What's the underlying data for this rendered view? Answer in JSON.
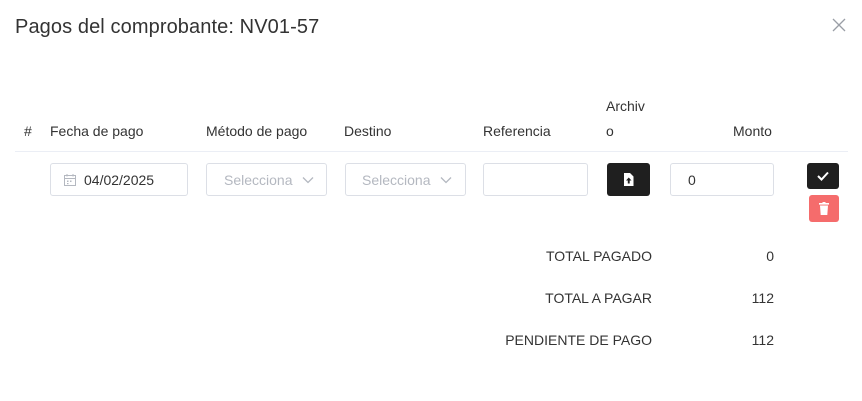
{
  "dialog": {
    "title": "Pagos del comprobante: NV01-57"
  },
  "icons": {
    "close": "close-icon",
    "calendar": "calendar-icon",
    "chevron": "chevron-down-icon",
    "upload": "upload-file-icon",
    "check": "check-icon",
    "trash": "trash-icon"
  },
  "table": {
    "headers": {
      "index": "#",
      "date": "Fecha de pago",
      "method": "Método de pago",
      "destination": "Destino",
      "reference": "Referencia",
      "file_line1": "Archiv",
      "file_line2": "o",
      "amount": "Monto"
    },
    "row": {
      "date_value": "04/02/2025",
      "method_placeholder": "Selecciona",
      "destination_placeholder": "Selecciona",
      "reference_value": "",
      "amount_value": "0"
    }
  },
  "totals": [
    {
      "label": "TOTAL PAGADO",
      "value": "0"
    },
    {
      "label": "TOTAL A PAGAR",
      "value": "112"
    },
    {
      "label": "PENDIENTE DE PAGO",
      "value": "112"
    }
  ],
  "colors": {
    "dark_button": "#1f1f1f",
    "delete_button": "#f56c6c",
    "border": "#dcdfe6"
  }
}
